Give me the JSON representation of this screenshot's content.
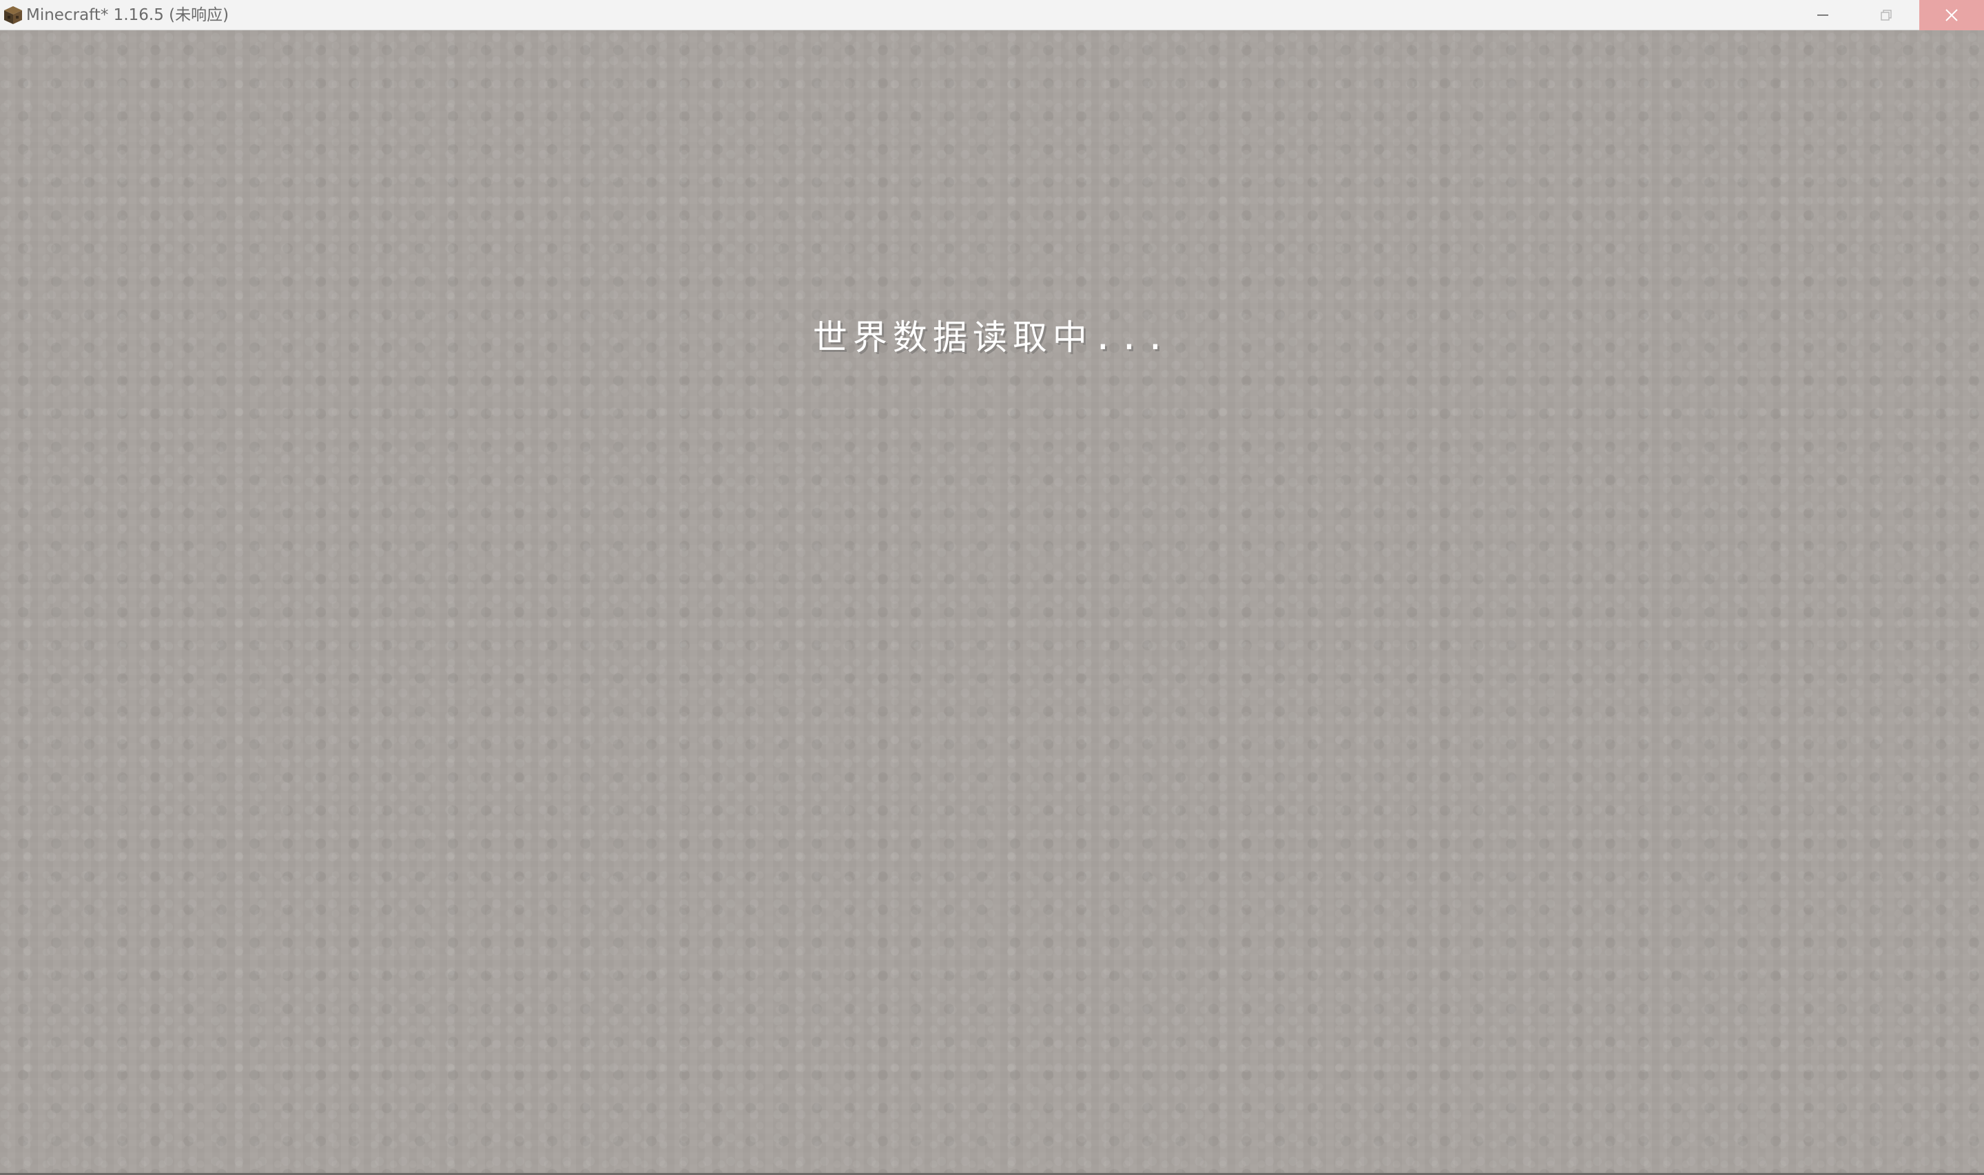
{
  "window": {
    "title": "Minecraft* 1.16.5 (未响应)",
    "icon": "minecraft-block-icon",
    "controls": {
      "minimize_icon": "minimize-icon",
      "maximize_icon": "restore-icon",
      "close_icon": "close-icon"
    }
  },
  "screen": {
    "loading_message": "世界数据读取中..."
  },
  "colors": {
    "background": "#a8a39f",
    "titlebar": "#f3f3f3",
    "close_hover": "#e8a5a5",
    "text": "#ffffff"
  }
}
